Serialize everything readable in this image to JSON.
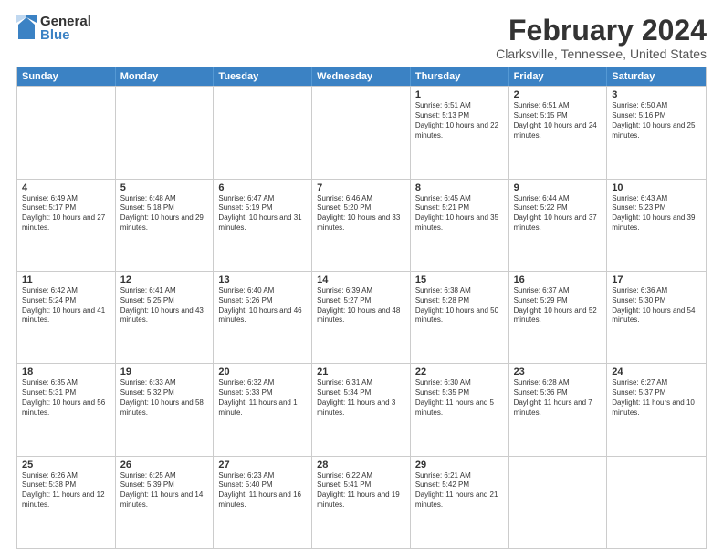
{
  "logo": {
    "general": "General",
    "blue": "Blue"
  },
  "title": "February 2024",
  "location": "Clarksville, Tennessee, United States",
  "headers": [
    "Sunday",
    "Monday",
    "Tuesday",
    "Wednesday",
    "Thursday",
    "Friday",
    "Saturday"
  ],
  "rows": [
    [
      {
        "day": "",
        "info": ""
      },
      {
        "day": "",
        "info": ""
      },
      {
        "day": "",
        "info": ""
      },
      {
        "day": "",
        "info": ""
      },
      {
        "day": "1",
        "info": "Sunrise: 6:51 AM\nSunset: 5:13 PM\nDaylight: 10 hours and 22 minutes."
      },
      {
        "day": "2",
        "info": "Sunrise: 6:51 AM\nSunset: 5:15 PM\nDaylight: 10 hours and 24 minutes."
      },
      {
        "day": "3",
        "info": "Sunrise: 6:50 AM\nSunset: 5:16 PM\nDaylight: 10 hours and 25 minutes."
      }
    ],
    [
      {
        "day": "4",
        "info": "Sunrise: 6:49 AM\nSunset: 5:17 PM\nDaylight: 10 hours and 27 minutes."
      },
      {
        "day": "5",
        "info": "Sunrise: 6:48 AM\nSunset: 5:18 PM\nDaylight: 10 hours and 29 minutes."
      },
      {
        "day": "6",
        "info": "Sunrise: 6:47 AM\nSunset: 5:19 PM\nDaylight: 10 hours and 31 minutes."
      },
      {
        "day": "7",
        "info": "Sunrise: 6:46 AM\nSunset: 5:20 PM\nDaylight: 10 hours and 33 minutes."
      },
      {
        "day": "8",
        "info": "Sunrise: 6:45 AM\nSunset: 5:21 PM\nDaylight: 10 hours and 35 minutes."
      },
      {
        "day": "9",
        "info": "Sunrise: 6:44 AM\nSunset: 5:22 PM\nDaylight: 10 hours and 37 minutes."
      },
      {
        "day": "10",
        "info": "Sunrise: 6:43 AM\nSunset: 5:23 PM\nDaylight: 10 hours and 39 minutes."
      }
    ],
    [
      {
        "day": "11",
        "info": "Sunrise: 6:42 AM\nSunset: 5:24 PM\nDaylight: 10 hours and 41 minutes."
      },
      {
        "day": "12",
        "info": "Sunrise: 6:41 AM\nSunset: 5:25 PM\nDaylight: 10 hours and 43 minutes."
      },
      {
        "day": "13",
        "info": "Sunrise: 6:40 AM\nSunset: 5:26 PM\nDaylight: 10 hours and 46 minutes."
      },
      {
        "day": "14",
        "info": "Sunrise: 6:39 AM\nSunset: 5:27 PM\nDaylight: 10 hours and 48 minutes."
      },
      {
        "day": "15",
        "info": "Sunrise: 6:38 AM\nSunset: 5:28 PM\nDaylight: 10 hours and 50 minutes."
      },
      {
        "day": "16",
        "info": "Sunrise: 6:37 AM\nSunset: 5:29 PM\nDaylight: 10 hours and 52 minutes."
      },
      {
        "day": "17",
        "info": "Sunrise: 6:36 AM\nSunset: 5:30 PM\nDaylight: 10 hours and 54 minutes."
      }
    ],
    [
      {
        "day": "18",
        "info": "Sunrise: 6:35 AM\nSunset: 5:31 PM\nDaylight: 10 hours and 56 minutes."
      },
      {
        "day": "19",
        "info": "Sunrise: 6:33 AM\nSunset: 5:32 PM\nDaylight: 10 hours and 58 minutes."
      },
      {
        "day": "20",
        "info": "Sunrise: 6:32 AM\nSunset: 5:33 PM\nDaylight: 11 hours and 1 minute."
      },
      {
        "day": "21",
        "info": "Sunrise: 6:31 AM\nSunset: 5:34 PM\nDaylight: 11 hours and 3 minutes."
      },
      {
        "day": "22",
        "info": "Sunrise: 6:30 AM\nSunset: 5:35 PM\nDaylight: 11 hours and 5 minutes."
      },
      {
        "day": "23",
        "info": "Sunrise: 6:28 AM\nSunset: 5:36 PM\nDaylight: 11 hours and 7 minutes."
      },
      {
        "day": "24",
        "info": "Sunrise: 6:27 AM\nSunset: 5:37 PM\nDaylight: 11 hours and 10 minutes."
      }
    ],
    [
      {
        "day": "25",
        "info": "Sunrise: 6:26 AM\nSunset: 5:38 PM\nDaylight: 11 hours and 12 minutes."
      },
      {
        "day": "26",
        "info": "Sunrise: 6:25 AM\nSunset: 5:39 PM\nDaylight: 11 hours and 14 minutes."
      },
      {
        "day": "27",
        "info": "Sunrise: 6:23 AM\nSunset: 5:40 PM\nDaylight: 11 hours and 16 minutes."
      },
      {
        "day": "28",
        "info": "Sunrise: 6:22 AM\nSunset: 5:41 PM\nDaylight: 11 hours and 19 minutes."
      },
      {
        "day": "29",
        "info": "Sunrise: 6:21 AM\nSunset: 5:42 PM\nDaylight: 11 hours and 21 minutes."
      },
      {
        "day": "",
        "info": ""
      },
      {
        "day": "",
        "info": ""
      }
    ]
  ]
}
